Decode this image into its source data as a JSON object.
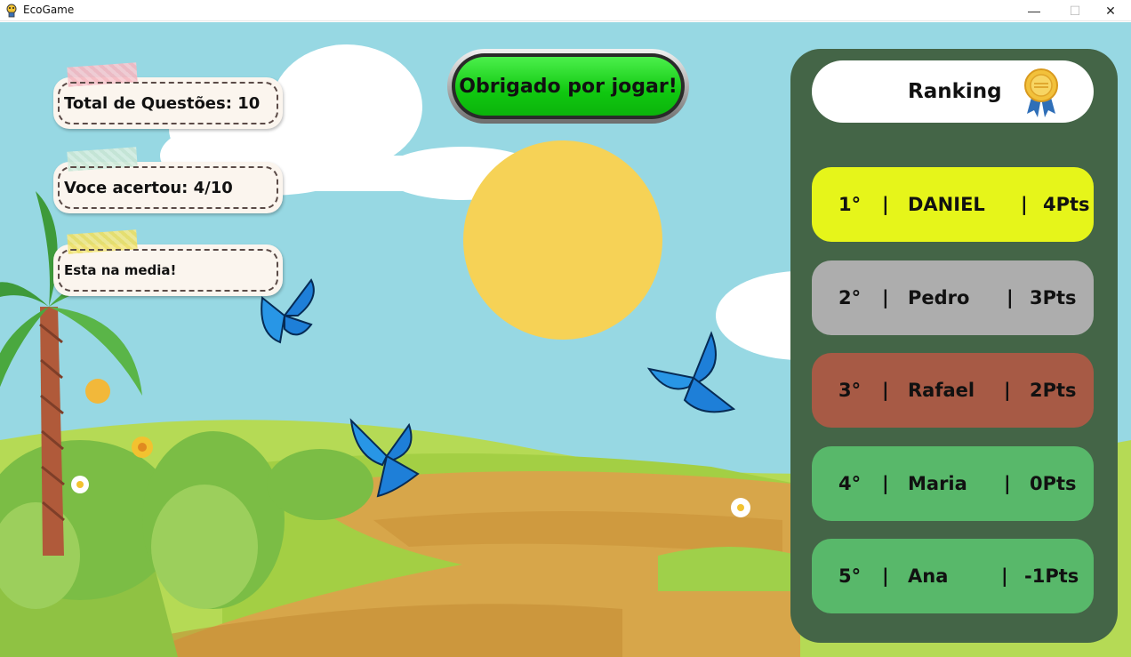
{
  "window": {
    "title": "EcoGame",
    "minimize_glyph": "—",
    "maximize_glyph": "☐",
    "close_glyph": "✕"
  },
  "stats": {
    "total_questions": "Total de Questões: 10",
    "correct": "Voce acertou: 4/10",
    "message": "Esta na media!"
  },
  "thanks_button": "Obrigado por jogar!",
  "ranking": {
    "title": "Ranking",
    "separator": "|",
    "rows": [
      {
        "position": "1°",
        "name": "DANIEL",
        "points": "4Pts",
        "color": "#e6f51a"
      },
      {
        "position": "2°",
        "name": "Pedro",
        "points": "3Pts",
        "color": "#adadad"
      },
      {
        "position": "3°",
        "name": "Rafael",
        "points": "2Pts",
        "color": "#a75a45"
      },
      {
        "position": "4°",
        "name": "Maria",
        "points": "0Pts",
        "color": "#58b86a"
      },
      {
        "position": "5°",
        "name": "Ana",
        "points": "-1Pts",
        "color": "#58b86a"
      }
    ]
  },
  "colors": {
    "sky": "#97d8e3",
    "sun": "#f6d256",
    "panel": "#446547",
    "path": "#d4a24a",
    "grass": "#a8d646"
  },
  "icons": [
    "app-icon",
    "medal-icon",
    "butterfly-icon",
    "palm-tree",
    "sun"
  ]
}
